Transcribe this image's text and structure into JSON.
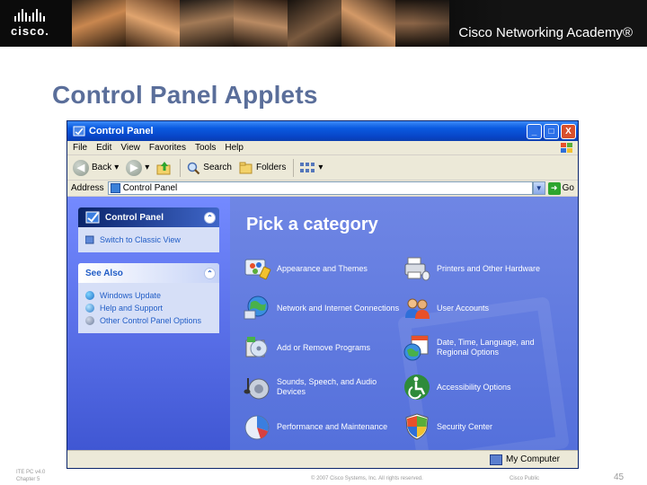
{
  "banner": {
    "brand": "cisco.",
    "academy": "Cisco Networking Academy®"
  },
  "slide": {
    "title": "Control Panel Applets",
    "footer_left_line1": "ITE PC v4.0",
    "footer_left_line2": "Chapter 5",
    "footer_copyright": "© 2007 Cisco Systems, Inc. All rights reserved.",
    "footer_classification": "Cisco Public",
    "page_number": "45"
  },
  "window": {
    "title": "Control Panel",
    "controls": {
      "minimize": "_",
      "maximize": "□",
      "close": "X"
    },
    "menu": [
      "File",
      "Edit",
      "View",
      "Favorites",
      "Tools",
      "Help"
    ],
    "toolbar": {
      "back": "Back",
      "search": "Search",
      "folders": "Folders"
    },
    "address": {
      "label": "Address",
      "value": "Control Panel",
      "go": "Go"
    },
    "sidebar": {
      "control_panel": {
        "title": "Control Panel",
        "link": "Switch to Classic View"
      },
      "see_also": {
        "title": "See Also",
        "links": [
          "Windows Update",
          "Help and Support",
          "Other Control Panel Options"
        ]
      }
    },
    "main": {
      "heading": "Pick a category",
      "categories": [
        {
          "label": "Appearance and Themes",
          "icon": "appearance-themes-icon"
        },
        {
          "label": "Printers and Other Hardware",
          "icon": "printers-hardware-icon"
        },
        {
          "label": "Network and Internet Connections",
          "icon": "network-internet-icon"
        },
        {
          "label": "User Accounts",
          "icon": "user-accounts-icon"
        },
        {
          "label": "Add or Remove Programs",
          "icon": "add-remove-programs-icon"
        },
        {
          "label": "Date, Time, Language, and Regional Options",
          "icon": "date-time-language-icon"
        },
        {
          "label": "Sounds, Speech, and Audio Devices",
          "icon": "sounds-audio-icon"
        },
        {
          "label": "Accessibility Options",
          "icon": "accessibility-icon"
        },
        {
          "label": "Performance and Maintenance",
          "icon": "performance-maintenance-icon"
        },
        {
          "label": "Security Center",
          "icon": "security-center-icon"
        }
      ]
    },
    "status": {
      "location": "My Computer"
    }
  }
}
